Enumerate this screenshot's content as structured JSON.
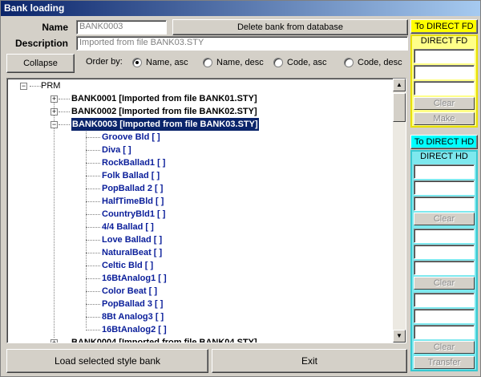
{
  "window": {
    "title": "Bank loading"
  },
  "form": {
    "name_label": "Name",
    "name_value": "BANK0003",
    "description_label": "Description",
    "description_value": "Imported from file BANK03.STY",
    "delete_button": "Delete bank from database",
    "collapse_button": "Collapse",
    "order_label": "Order by:",
    "order_options": [
      "Name, asc",
      "Name, desc",
      "Code, asc",
      "Code, desc"
    ],
    "order_selected": "Name, asc"
  },
  "tree": {
    "root": "PRM",
    "banks": [
      "BANK0001 [Imported from file BANK01.STY]",
      "BANK0002 [Imported from file BANK02.STY]",
      "BANK0003 [Imported from file BANK03.STY]",
      "BANK0004 [Imported from file BANK04.STY]"
    ],
    "selected_bank": "BANK0003 [Imported from file BANK03.STY]",
    "styles": [
      "Groove Bld [ ]",
      "Diva [ ]",
      "RockBallad1 [ ]",
      "Folk Ballad [ ]",
      "PopBallad 2 [ ]",
      "HalfTimeBld [ ]",
      "CountryBld1 [ ]",
      "4/4 Ballad [ ]",
      "Love Ballad [ ]",
      "NaturalBeat [ ]",
      "Celtic Bld [ ]",
      "16BtAnalog1 [ ]",
      "Color Beat [ ]",
      "PopBallad 3 [ ]",
      "8Bt Analog3 [ ]",
      "16BtAnalog2 [ ]"
    ]
  },
  "footer": {
    "load_button": "Load selected style bank",
    "exit_button": "Exit"
  },
  "direct_fd": {
    "to_label": "To DIRECT FD",
    "title": "DIRECT FD",
    "clear": "Clear",
    "make": "Make"
  },
  "direct_hd": {
    "to_label": "To DIRECT HD",
    "title": "DIRECT HD",
    "clear": "Clear",
    "transfer": "Transfer"
  },
  "colors": {
    "fd_accent": "#ffff00",
    "hd_accent": "#00ffff",
    "style_text": "#0a1e9a",
    "selection": "#0a246a"
  }
}
